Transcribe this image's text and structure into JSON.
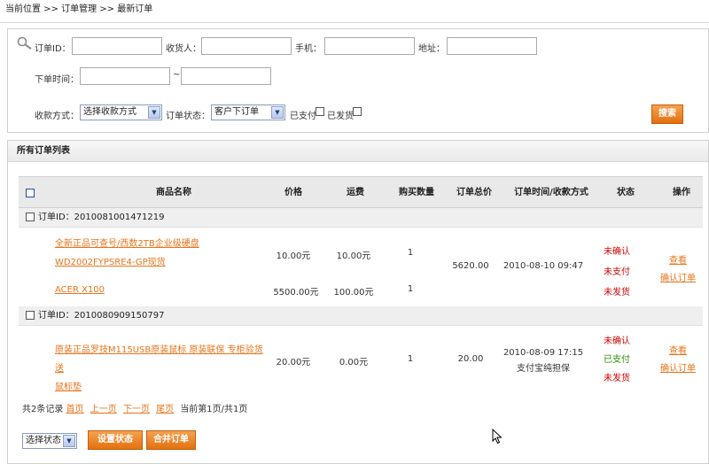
{
  "breadcrumb": "当前位置 >> 订单管理 >> 最新订单",
  "filters": {
    "order_id_label": "订单ID：",
    "receiver_label": "收货人：",
    "phone_label": "手机：",
    "address_label": "地址：",
    "order_time_label": "下单时间：",
    "time_sep": "~",
    "pay_method_label": "收款方式：",
    "pay_method_value": "选择收款方式",
    "order_status_label": "订单状态：",
    "order_status_value": "客户下订单",
    "paid_label": "已支付",
    "shipped_label": "已发货",
    "search_button": "搜索"
  },
  "list": {
    "title": "所有订单列表",
    "columns": [
      "商品名称",
      "价格",
      "运费",
      "购买数量",
      "订单总价",
      "订单时间/收款方式",
      "状态",
      "操作"
    ],
    "orders": [
      {
        "id_text": "订单ID：2010081001471219",
        "items": [
          {
            "name_line1": "全新正品可查号/西数2TB企业级硬盘",
            "name_line2": "WD2002FYPSRE4-GP现货",
            "price": "10.00元",
            "shipping": "10.00元",
            "qty": "1"
          },
          {
            "name_line1": "ACER X100",
            "price": "5500.00元",
            "shipping": "100.00元",
            "qty": "1"
          }
        ],
        "total": "5620.00",
        "time": "2010-08-10 09:47",
        "payment": "",
        "status": [
          "未确认",
          "未支付",
          "未发货"
        ],
        "actions": [
          "查看",
          "确认订单"
        ]
      },
      {
        "id_text": "订单ID：2010080909150797",
        "items": [
          {
            "name_line1": "原装正品罗技M115USB原装鼠标 原装联保 专柜验货 送",
            "name_line2": "鼠标垫",
            "price": "20.00元",
            "shipping": "0.00元",
            "qty": "1"
          }
        ],
        "total": "20.00",
        "time": "2010-08-09 17:15",
        "payment": "支付宝纯担保",
        "status": [
          "未确认",
          "已支付",
          "未发货"
        ],
        "actions": [
          "查看",
          "确认订单"
        ]
      }
    ],
    "pager": {
      "summary": "共2条记录",
      "first": "首页",
      "prev": "上一页",
      "next": "下一页",
      "last": "尾页",
      "current": "当前第1页/共1页"
    },
    "bottom": {
      "status_select": "选择状态",
      "set_status_button": "设置状态",
      "merge_button": "合并订单"
    }
  },
  "colors": {
    "accent_orange": "#e8741a",
    "status_red": "#d40000",
    "status_green": "#2a8a00"
  }
}
